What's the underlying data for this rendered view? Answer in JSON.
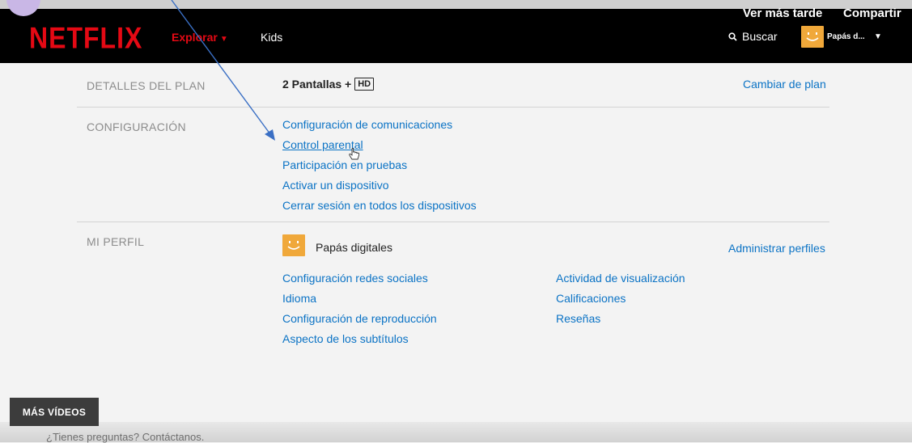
{
  "header": {
    "logo": "NETFLIX",
    "nav_explore": "Explorar",
    "nav_kids": "Kids",
    "search_label": "Buscar",
    "profile_name": "Papás d...",
    "watch_later": "Ver más tarde",
    "share": "Compartir"
  },
  "plan": {
    "label": "DETALLES DEL PLAN",
    "value": "2 Pantallas +",
    "badge": "HD",
    "change_link": "Cambiar de plan"
  },
  "settings": {
    "label": "CONFIGURACIÓN",
    "links": [
      "Configuración de comunicaciones",
      "Control parental",
      "Participación en pruebas",
      "Activar un dispositivo",
      "Cerrar sesión en todos los dispositivos"
    ]
  },
  "profile": {
    "label": "MI PERFIL",
    "name": "Papás digitales",
    "manage_link": "Administrar perfiles",
    "links_left": [
      "Configuración redes sociales",
      "Idioma",
      "Configuración de reproducción",
      "Aspecto de los subtítulos"
    ],
    "links_right": [
      "Actividad de visualización",
      "Calificaciones",
      "Reseñas"
    ]
  },
  "footer": {
    "more_videos": "MÁS VÍDEOS",
    "contact": "¿Tienes preguntas? Contáctanos."
  },
  "colors": {
    "brand": "#e50914",
    "link": "#0b73c5",
    "avatar": "#f0a83a"
  }
}
